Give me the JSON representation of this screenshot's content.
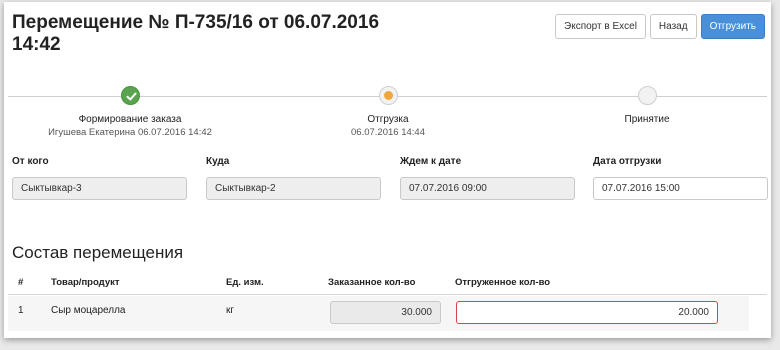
{
  "header": {
    "title": "Перемещение № П-735/16 от 06.07.2016 14:42"
  },
  "toolbar": {
    "export_label": "Экспорт в Excel",
    "back_label": "Назад",
    "ship_label": "Отгрузить"
  },
  "colors": {
    "primary": "#4a90d9",
    "step_done": "#5aa34f",
    "step_active": "#f0a63a",
    "error_border": "#d64545"
  },
  "steps": [
    {
      "label": "Формирование заказа",
      "sub": "Игушева Екатерина 06.07.2016 14:42",
      "state": "done",
      "icon": "check-icon"
    },
    {
      "label": "Отгрузка",
      "sub": "06.07.2016 14:44",
      "state": "active",
      "icon": "dot-icon"
    },
    {
      "label": "Принятие",
      "sub": "",
      "state": "pending",
      "icon": ""
    }
  ],
  "fields": {
    "from": {
      "label": "От кого",
      "value": "Сыктывкар-3"
    },
    "to": {
      "label": "Куда",
      "value": "Сыктывкар-2"
    },
    "expected": {
      "label": "Ждем к дате",
      "value": "07.07.2016 09:00"
    },
    "ship_date": {
      "label": "Дата отгрузки",
      "value": "07.07.2016 15:00"
    }
  },
  "composition": {
    "title": "Состав перемещения",
    "columns": [
      "#",
      "Товар/продукт",
      "Ед. изм.",
      "Заказанное кол-во",
      "Отгруженное кол-во"
    ],
    "rows": [
      {
        "num": "1",
        "product": "Сыр моцарелла",
        "unit": "кг",
        "ordered": "30.000",
        "shipped": "20.000"
      }
    ]
  }
}
